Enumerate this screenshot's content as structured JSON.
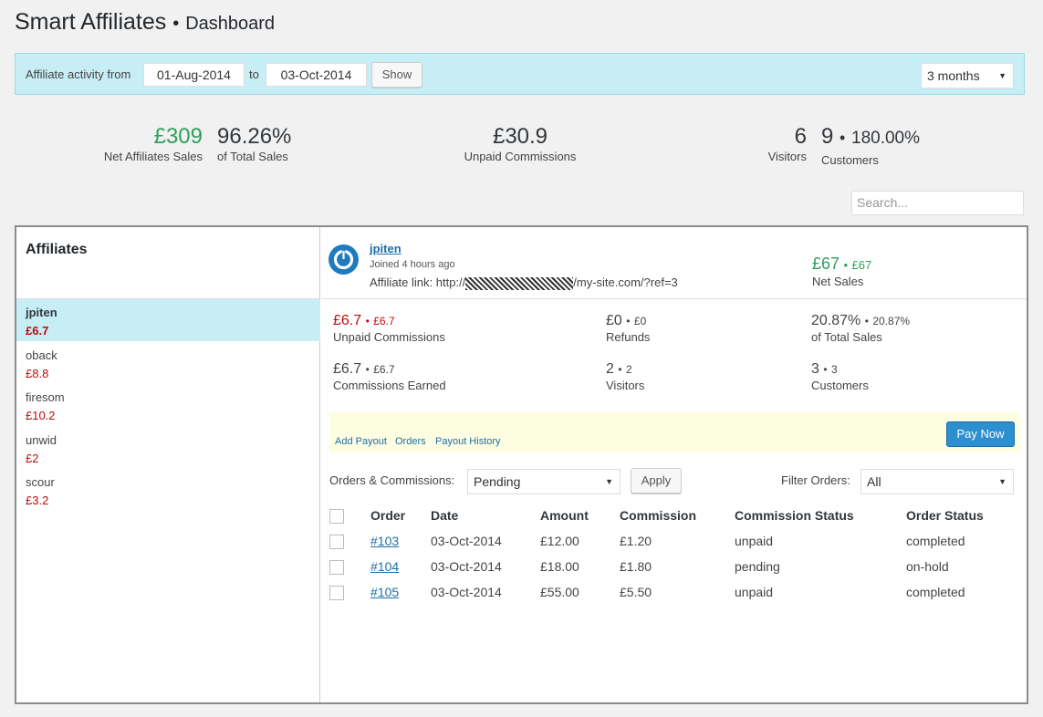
{
  "header": {
    "app_title": "Smart Affiliates",
    "separator": "•",
    "page": "Dashboard"
  },
  "filter": {
    "label": "Affiliate activity from",
    "from_date": "01-Aug-2014",
    "to_label": "to",
    "to_date": "03-Oct-2014",
    "show_label": "Show",
    "period": "3 months"
  },
  "summary": {
    "net_sales_value": "£309",
    "net_sales_label": "Net Affiliates Sales",
    "pct_value": "96.26%",
    "pct_label": "of Total Sales",
    "unpaid_value": "£30.9",
    "unpaid_label": "Unpaid Commissions",
    "visitors_value": "6",
    "visitors_label": "Visitors",
    "customers_value": "9",
    "customers_pct": "180.00%",
    "customers_label": "Customers"
  },
  "search": {
    "placeholder": "Search..."
  },
  "affiliates": {
    "title": "Affiliates",
    "items": [
      {
        "name": "jpiten",
        "amount": "£6.7"
      },
      {
        "name": "oback",
        "amount": "£8.8"
      },
      {
        "name": "firesom",
        "amount": "£10.2"
      },
      {
        "name": "unwid",
        "amount": "£2"
      },
      {
        "name": "scour",
        "amount": "£3.2"
      }
    ]
  },
  "detail": {
    "name": "jpiten",
    "joined": "Joined 4 hours ago",
    "link_label": "Affiliate link: http://",
    "link_suffix": "/my-site.com/?ref=3",
    "net_sales_value": "£67",
    "net_sales_small": "£67",
    "net_sales_label": "Net Sales",
    "metrics": {
      "unpaid": {
        "value": "£6.7",
        "small": "£6.7",
        "label": "Unpaid Commissions"
      },
      "refunds": {
        "value": "£0",
        "small": "£0",
        "label": "Refunds"
      },
      "total_sales": {
        "value": "20.87%",
        "small": "20.87%",
        "label": "of Total Sales"
      },
      "earned": {
        "value": "£6.7",
        "small": "£6.7",
        "label": "Commissions Earned"
      },
      "visitors": {
        "value": "2",
        "small": "2",
        "label": "Visitors"
      },
      "customers": {
        "value": "3",
        "small": "3",
        "label": "Customers"
      }
    },
    "links": {
      "add_payout": "Add Payout",
      "orders": "Orders",
      "payout_history": "Payout History"
    },
    "pay_now": "Pay Now"
  },
  "orders": {
    "label": "Orders & Commissions:",
    "status_filter": "Pending",
    "apply": "Apply",
    "filter_label": "Filter Orders:",
    "filter_value": "All",
    "columns": [
      "Order",
      "Date",
      "Amount",
      "Commission",
      "Commission Status",
      "Order Status"
    ],
    "rows": [
      {
        "order": "#103",
        "date": "03-Oct-2014",
        "amount": "£12.00",
        "commission": "£1.20",
        "commission_status": "unpaid",
        "order_status": "completed"
      },
      {
        "order": "#104",
        "date": "03-Oct-2014",
        "amount": "£18.00",
        "commission": "£1.80",
        "commission_status": "pending",
        "order_status": "on-hold"
      },
      {
        "order": "#105",
        "date": "03-Oct-2014",
        "amount": "£55.00",
        "commission": "£5.50",
        "commission_status": "unpaid",
        "order_status": "completed"
      }
    ]
  }
}
